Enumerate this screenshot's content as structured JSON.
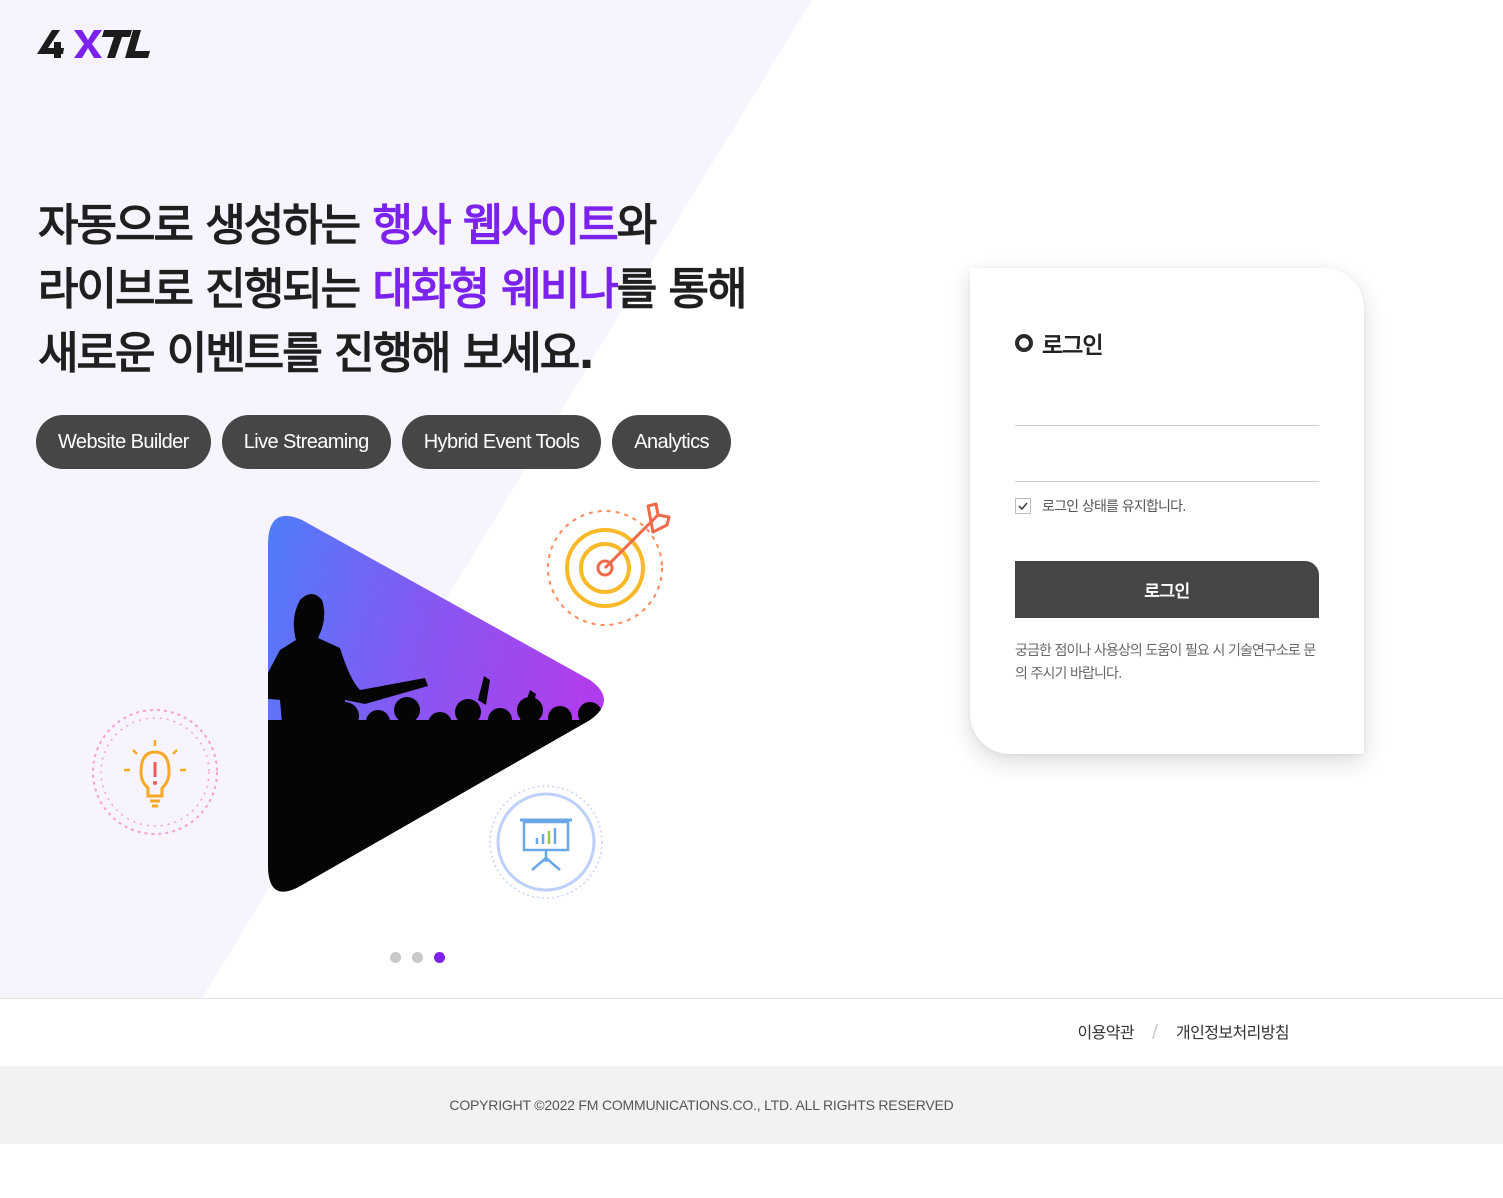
{
  "brand": {
    "logo_text": "4XTL",
    "accent": "#7b22ec",
    "dark": "#464646"
  },
  "hero": {
    "line1_pre": "자동으로 생성하는 ",
    "line1_hl": "행사 웹사이트",
    "line1_post": "와",
    "line2_pre": "라이브로 진행되는 ",
    "line2_hl": "대화형 웨비나",
    "line2_post": "를 통해",
    "line3": "새로운 이벤트를 진행해 보세요.",
    "tags": [
      "Website Builder",
      "Live Streaming",
      "Hybrid Event Tools",
      "Analytics"
    ],
    "illustration_icons": [
      "target-icon",
      "lightbulb-icon",
      "presentation-chart-icon"
    ],
    "slides": {
      "count": 3,
      "active": 3
    }
  },
  "login": {
    "title": "로그인",
    "id_value": "",
    "password_value": "",
    "remember_label": "로그인 상태를 유지합니다.",
    "remember_checked": true,
    "button_label": "로그인",
    "help_text": "궁금한 점이나 사용상의 도움이 필요 시 기술연구소로 문의 주시기 바랍니다."
  },
  "footer": {
    "terms": "이용약관",
    "separator": "/",
    "privacy": "개인정보처리방침",
    "copyright": "COPYRIGHT ©2022  FM COMMUNICATIONS.CO., LTD. ALL RIGHTS RESERVED"
  }
}
